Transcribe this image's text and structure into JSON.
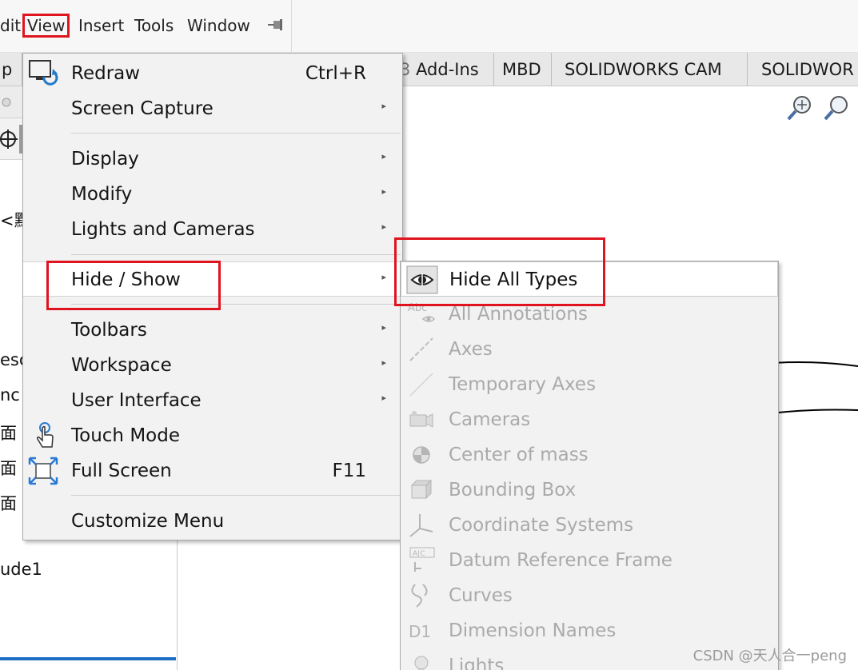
{
  "menubar": {
    "items": [
      "dit",
      "View",
      "Insert",
      "Tools",
      "Window"
    ],
    "pin_icon": "pushpin-icon"
  },
  "tabs": [
    "p",
    "Add-Ins",
    "MBD",
    "SOLIDWORKS CAM",
    "SOLIDWOR"
  ],
  "tab_partial_char": "3",
  "left_panel": {
    "lines": [
      "<默",
      "esc",
      "nc",
      "面",
      "面",
      "面",
      "ude1"
    ]
  },
  "view_menu": {
    "items": [
      {
        "label": "Redraw",
        "shortcut": "Ctrl+R",
        "icon": "redraw-icon"
      },
      {
        "label": "Screen Capture"
      },
      {
        "label": "Display"
      },
      {
        "label": "Modify"
      },
      {
        "label": "Lights and Cameras"
      },
      {
        "label": "Hide / Show"
      },
      {
        "label": "Toolbars"
      },
      {
        "label": "Workspace"
      },
      {
        "label": "User Interface"
      },
      {
        "label": "Touch Mode",
        "icon": "touch-hand-icon"
      },
      {
        "label": "Full Screen",
        "shortcut": "F11",
        "icon": "full-screen-icon"
      },
      {
        "label": "Customize Menu"
      }
    ],
    "submenu_arrow": "▸"
  },
  "hide_show_submenu": {
    "items": [
      {
        "label": "Hide All Types",
        "icon": "eye-icon",
        "enabled": true
      },
      {
        "label": "All Annotations",
        "icon": "annotation-icon",
        "enabled": false
      },
      {
        "label": "Axes",
        "icon": "axis-icon",
        "enabled": false
      },
      {
        "label": "Temporary Axes",
        "icon": "temporary-axis-icon",
        "enabled": false
      },
      {
        "label": "Cameras",
        "icon": "camera-icon",
        "enabled": false
      },
      {
        "label": "Center of mass",
        "icon": "center-of-mass-icon",
        "enabled": false
      },
      {
        "label": "Bounding Box",
        "icon": "bounding-box-icon",
        "enabled": false
      },
      {
        "label": "Coordinate Systems",
        "icon": "coordinate-system-icon",
        "enabled": false
      },
      {
        "label": "Datum Reference Frame",
        "icon": "datum-reference-frame-icon",
        "enabled": false
      },
      {
        "label": "Curves",
        "icon": "curve-icon",
        "enabled": false
      },
      {
        "label": "Dimension Names",
        "icon": "dimension-name-icon",
        "enabled": false
      },
      {
        "label": "Lights",
        "icon": "light-bulb-icon",
        "enabled": false
      }
    ],
    "icon_text": {
      "annotation": "Abc",
      "dimension": "D1",
      "datum": "A|C"
    }
  },
  "watermark": "CSDN @天人合一peng",
  "colors": {
    "annotation_red": "#e0141e",
    "accent_blue": "#1e6fc4"
  }
}
